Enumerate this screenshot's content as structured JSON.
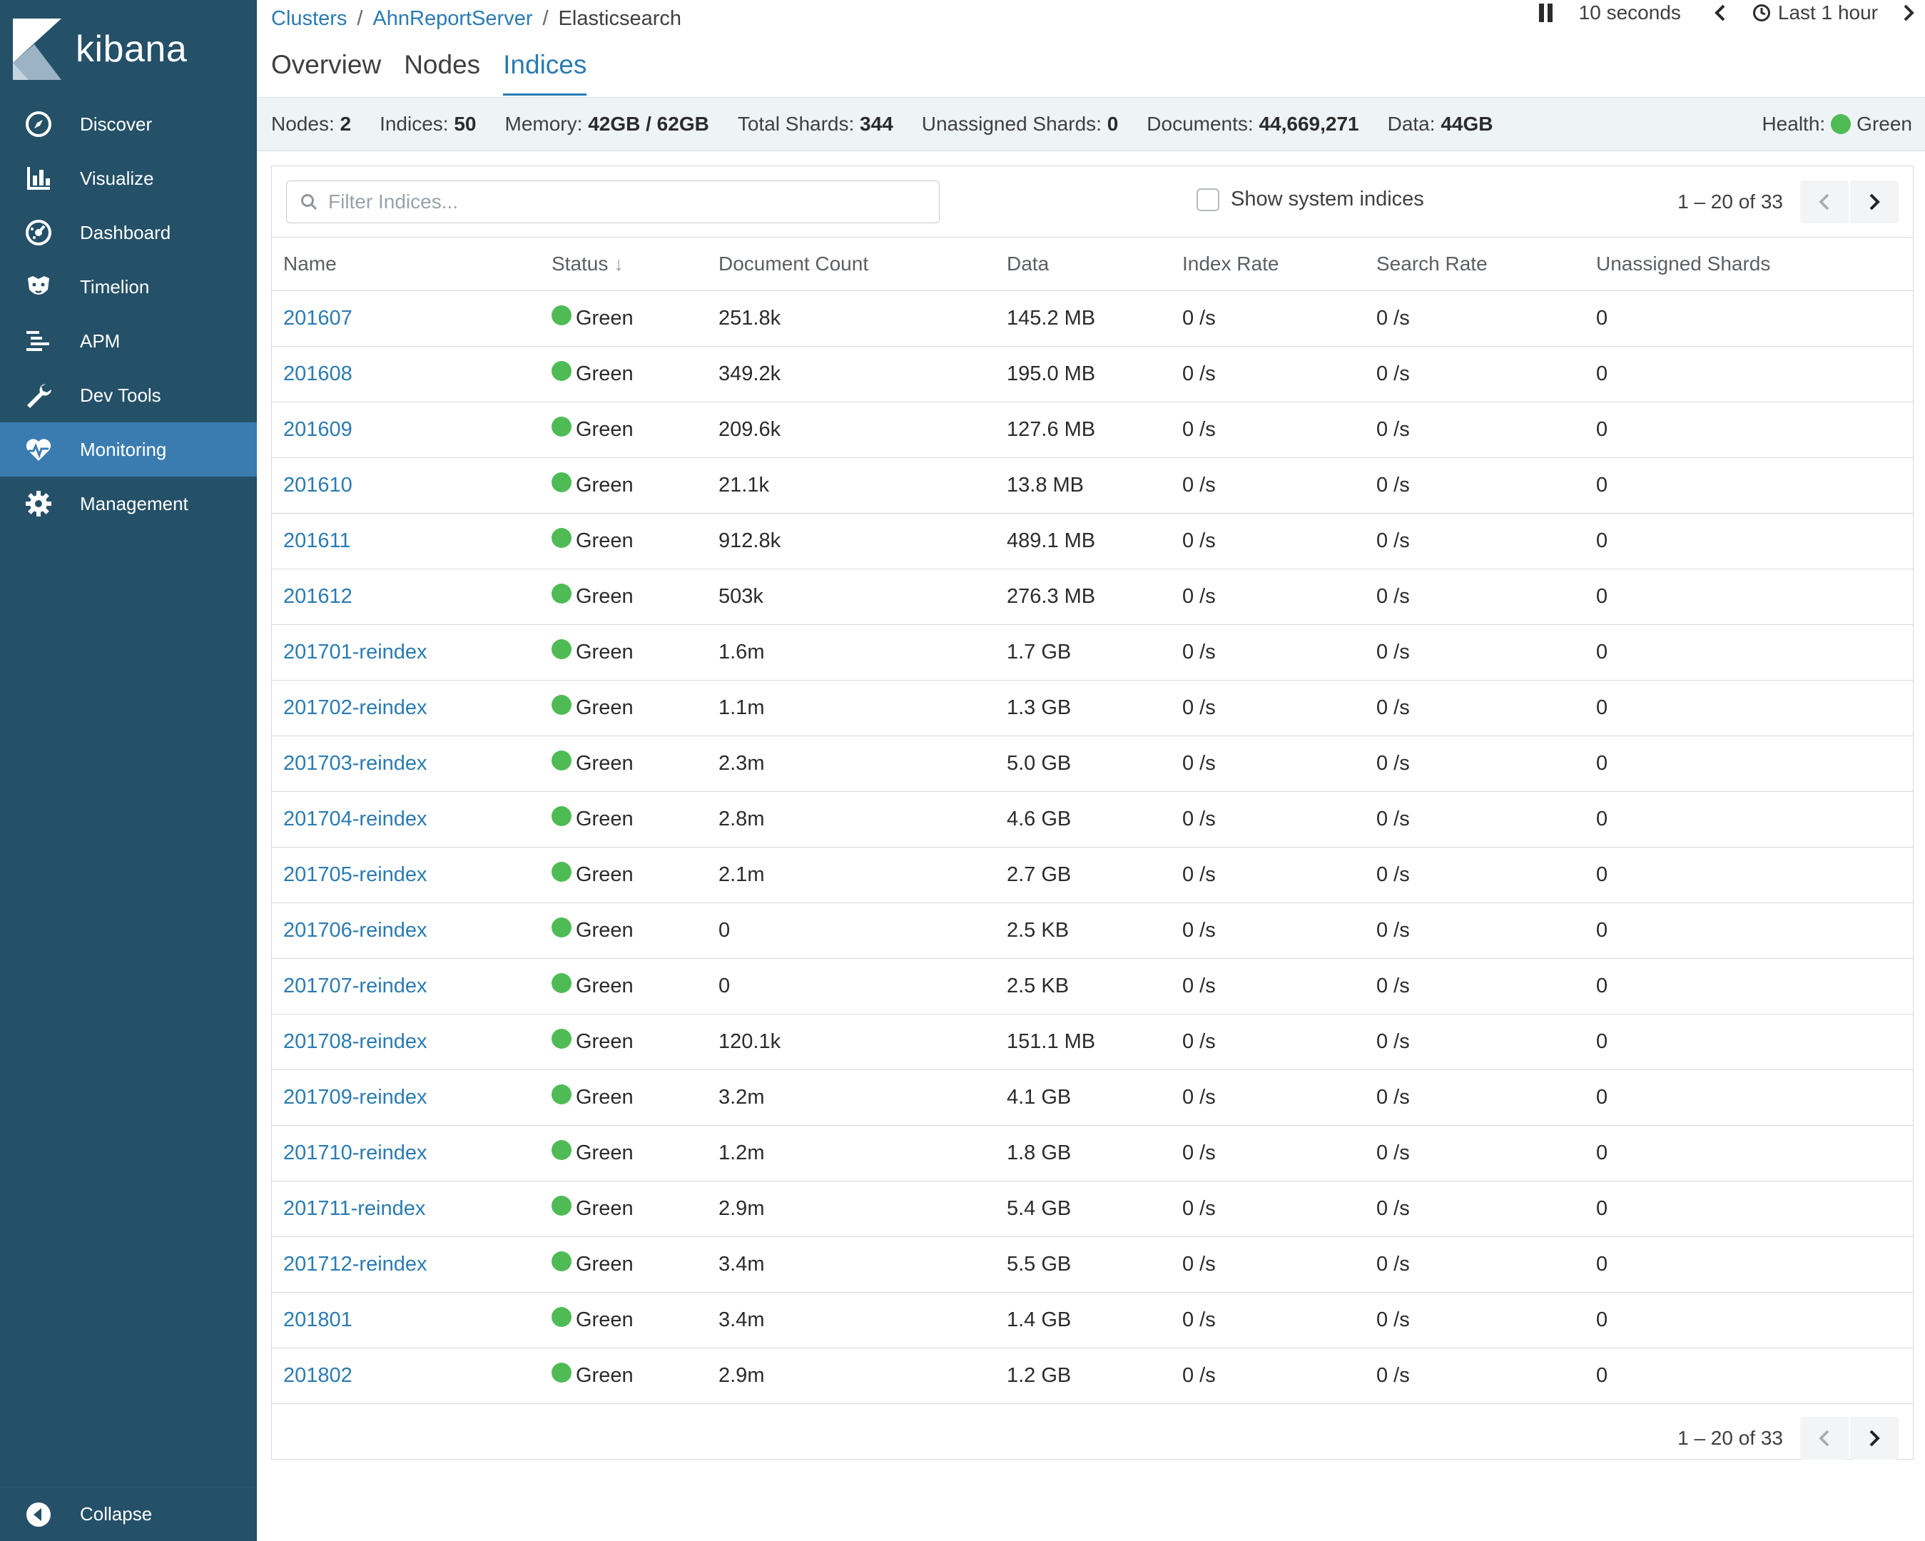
{
  "sidebar": {
    "brand": "kibana",
    "items": [
      {
        "label": "Discover",
        "icon": "compass-icon"
      },
      {
        "label": "Visualize",
        "icon": "bar-chart-icon"
      },
      {
        "label": "Dashboard",
        "icon": "dashboard-icon"
      },
      {
        "label": "Timelion",
        "icon": "timelion-icon"
      },
      {
        "label": "APM",
        "icon": "apm-icon"
      },
      {
        "label": "Dev Tools",
        "icon": "wrench-icon"
      },
      {
        "label": "Monitoring",
        "icon": "heartbeat-icon",
        "active": true
      },
      {
        "label": "Management",
        "icon": "gear-icon"
      }
    ],
    "collapse_label": "Collapse"
  },
  "breadcrumb": {
    "clusters": "Clusters",
    "server": "AhnReportServer",
    "current": "Elasticsearch",
    "sep": "/"
  },
  "controls": {
    "refresh_interval": "10 seconds",
    "time_range": "Last 1 hour"
  },
  "tabs": [
    "Overview",
    "Nodes",
    "Indices"
  ],
  "active_tab": "Indices",
  "summary": {
    "nodes_label": "Nodes:",
    "nodes": "2",
    "indices_label": "Indices:",
    "indices": "50",
    "memory_label": "Memory:",
    "memory": "42GB / 62GB",
    "shards_label": "Total Shards:",
    "shards": "344",
    "unassigned_label": "Unassigned Shards:",
    "unassigned": "0",
    "documents_label": "Documents:",
    "documents": "44,669,271",
    "data_label": "Data:",
    "data": "44GB",
    "health_label": "Health:",
    "health": "Green"
  },
  "toolbar": {
    "filter_placeholder": "Filter Indices...",
    "system_indices_label": "Show system indices",
    "pager": "1 – 20 of 33"
  },
  "table": {
    "columns": [
      "Name",
      "Status",
      "Document Count",
      "Data",
      "Index Rate",
      "Search Rate",
      "Unassigned Shards"
    ],
    "sort_indicator": "↓",
    "rows": [
      {
        "name": "201607",
        "status": "Green",
        "docs": "251.8k",
        "data": "145.2 MB",
        "index_rate": "0 /s",
        "search_rate": "0 /s",
        "unassigned": "0"
      },
      {
        "name": "201608",
        "status": "Green",
        "docs": "349.2k",
        "data": "195.0 MB",
        "index_rate": "0 /s",
        "search_rate": "0 /s",
        "unassigned": "0"
      },
      {
        "name": "201609",
        "status": "Green",
        "docs": "209.6k",
        "data": "127.6 MB",
        "index_rate": "0 /s",
        "search_rate": "0 /s",
        "unassigned": "0"
      },
      {
        "name": "201610",
        "status": "Green",
        "docs": "21.1k",
        "data": "13.8 MB",
        "index_rate": "0 /s",
        "search_rate": "0 /s",
        "unassigned": "0"
      },
      {
        "name": "201611",
        "status": "Green",
        "docs": "912.8k",
        "data": "489.1 MB",
        "index_rate": "0 /s",
        "search_rate": "0 /s",
        "unassigned": "0"
      },
      {
        "name": "201612",
        "status": "Green",
        "docs": "503k",
        "data": "276.3 MB",
        "index_rate": "0 /s",
        "search_rate": "0 /s",
        "unassigned": "0"
      },
      {
        "name": "201701-reindex",
        "status": "Green",
        "docs": "1.6m",
        "data": "1.7 GB",
        "index_rate": "0 /s",
        "search_rate": "0 /s",
        "unassigned": "0"
      },
      {
        "name": "201702-reindex",
        "status": "Green",
        "docs": "1.1m",
        "data": "1.3 GB",
        "index_rate": "0 /s",
        "search_rate": "0 /s",
        "unassigned": "0"
      },
      {
        "name": "201703-reindex",
        "status": "Green",
        "docs": "2.3m",
        "data": "5.0 GB",
        "index_rate": "0 /s",
        "search_rate": "0 /s",
        "unassigned": "0"
      },
      {
        "name": "201704-reindex",
        "status": "Green",
        "docs": "2.8m",
        "data": "4.6 GB",
        "index_rate": "0 /s",
        "search_rate": "0 /s",
        "unassigned": "0"
      },
      {
        "name": "201705-reindex",
        "status": "Green",
        "docs": "2.1m",
        "data": "2.7 GB",
        "index_rate": "0 /s",
        "search_rate": "0 /s",
        "unassigned": "0"
      },
      {
        "name": "201706-reindex",
        "status": "Green",
        "docs": "0",
        "data": "2.5 KB",
        "index_rate": "0 /s",
        "search_rate": "0 /s",
        "unassigned": "0"
      },
      {
        "name": "201707-reindex",
        "status": "Green",
        "docs": "0",
        "data": "2.5 KB",
        "index_rate": "0 /s",
        "search_rate": "0 /s",
        "unassigned": "0"
      },
      {
        "name": "201708-reindex",
        "status": "Green",
        "docs": "120.1k",
        "data": "151.1 MB",
        "index_rate": "0 /s",
        "search_rate": "0 /s",
        "unassigned": "0"
      },
      {
        "name": "201709-reindex",
        "status": "Green",
        "docs": "3.2m",
        "data": "4.1 GB",
        "index_rate": "0 /s",
        "search_rate": "0 /s",
        "unassigned": "0"
      },
      {
        "name": "201710-reindex",
        "status": "Green",
        "docs": "1.2m",
        "data": "1.8 GB",
        "index_rate": "0 /s",
        "search_rate": "0 /s",
        "unassigned": "0"
      },
      {
        "name": "201711-reindex",
        "status": "Green",
        "docs": "2.9m",
        "data": "5.4 GB",
        "index_rate": "0 /s",
        "search_rate": "0 /s",
        "unassigned": "0"
      },
      {
        "name": "201712-reindex",
        "status": "Green",
        "docs": "3.4m",
        "data": "5.5 GB",
        "index_rate": "0 /s",
        "search_rate": "0 /s",
        "unassigned": "0"
      },
      {
        "name": "201801",
        "status": "Green",
        "docs": "3.4m",
        "data": "1.4 GB",
        "index_rate": "0 /s",
        "search_rate": "0 /s",
        "unassigned": "0"
      },
      {
        "name": "201802",
        "status": "Green",
        "docs": "2.9m",
        "data": "1.2 GB",
        "index_rate": "0 /s",
        "search_rate": "0 /s",
        "unassigned": "0"
      }
    ]
  },
  "colors": {
    "sidebar": "#245068",
    "sidebar_active": "#3a7cb0",
    "link": "#2a7bb3",
    "health_green": "#4fbb55",
    "status_bar": "#eef3f6"
  }
}
